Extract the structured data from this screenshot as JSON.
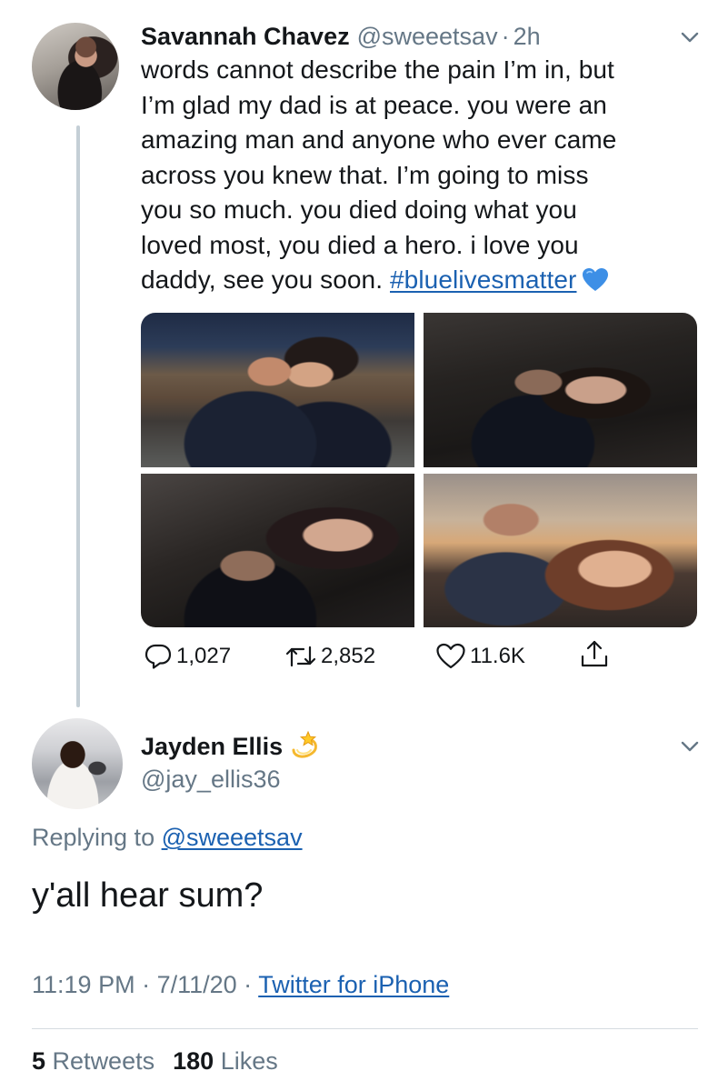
{
  "tweet": {
    "author_name": "Savannah Chavez",
    "author_handle": "@sweeetsav",
    "separator": "·",
    "time_ago": "2h",
    "text_lines": [
      "words cannot describe the pain I’m in, but",
      "I’m glad my dad is at peace. you were an",
      "amazing man and anyone who ever came",
      "across you knew that. I’m going to miss",
      "you so much. you died doing what you",
      "loved most, you died a hero. i love you"
    ],
    "last_line_text": "daddy, see you soon. ",
    "hashtag": "#bluelivesmatter",
    "emoji": "blue-heart",
    "photos": [
      "photo-1",
      "photo-2",
      "photo-3",
      "photo-4"
    ],
    "reply_count": "1,027",
    "retweet_count": "2,852",
    "like_count": "11.6K"
  },
  "reply": {
    "author_name": "Jayden Ellis",
    "author_emoji": "dizzy",
    "author_handle": "@jay_ellis36",
    "replying_prefix": "Replying to ",
    "replying_to": "@sweeetsav",
    "text": "y'all hear sum?",
    "time": "11:19 PM",
    "separator_1": " · ",
    "date": "7/11/20",
    "separator_2": " · ",
    "source": "Twitter for iPhone",
    "retweets_count": "5",
    "retweets_label": "Retweets",
    "likes_count": "180",
    "likes_label": "Likes"
  },
  "colors": {
    "link": "#1b61b1",
    "secondary_text": "#657786",
    "primary_text": "#14171a",
    "thread_line": "#c4cfd6"
  },
  "icons": [
    "chevron-down-icon",
    "reply-icon",
    "retweet-icon",
    "like-icon",
    "share-icon"
  ]
}
